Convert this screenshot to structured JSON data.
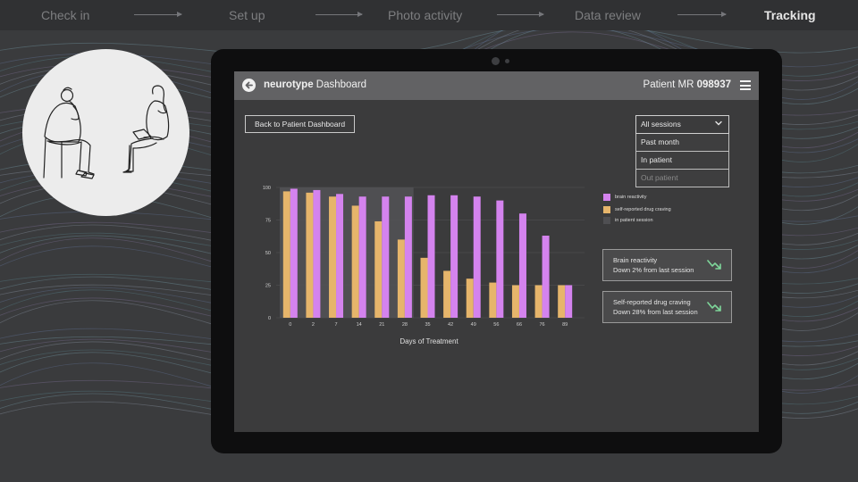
{
  "stepper": {
    "steps": [
      "Check in",
      "Set up",
      "Photo activity",
      "Data review",
      "Tracking"
    ],
    "active_index": 4
  },
  "tablet": {
    "brand_bold": "neurotype",
    "brand_rest": " Dashboard",
    "patient_prefix": "Patient MR ",
    "patient_id": "098937",
    "back_button_label": "Back to Patient Dashboard",
    "dropdown": {
      "selected": "All sessions",
      "options": [
        "Past month",
        "In patient",
        "Out patient"
      ]
    },
    "legend": {
      "brain": "brain reactivity",
      "craving": "self-reported drug craving",
      "session": "in patient session"
    },
    "cards": [
      {
        "title": "Brain reactivity",
        "subtitle": "Down 2% from last session"
      },
      {
        "title": "Self-reported drug craving",
        "subtitle": "Down 28% from last session"
      }
    ]
  },
  "colors": {
    "brain": "#d483ee",
    "craving": "#e6b56b",
    "session": "#4f4f52",
    "trend": "#7ed69a"
  },
  "icons": [
    "back-arrow-icon",
    "menu-icon",
    "chevron-down-icon",
    "trend-down-icon"
  ],
  "chart_data": {
    "type": "bar",
    "xlabel": "Days of Treatment",
    "ylabel": "",
    "ylim": [
      0,
      100
    ],
    "yticks": [
      0,
      25,
      50,
      75,
      100
    ],
    "categories": [
      "0",
      "2",
      "7",
      "14",
      "21",
      "28",
      "35",
      "42",
      "49",
      "56",
      "66",
      "76",
      "89"
    ],
    "series": [
      {
        "name": "self-reported drug craving",
        "values": [
          97,
          96,
          93,
          86,
          74,
          60,
          46,
          36,
          30,
          27,
          25,
          25,
          25
        ]
      },
      {
        "name": "brain reactivity",
        "values": [
          99,
          98,
          95,
          93,
          93,
          93,
          94,
          94,
          93,
          90,
          80,
          63,
          25
        ]
      }
    ],
    "in_patient_session_days": [
      "0",
      "2",
      "7",
      "14",
      "21",
      "28"
    ],
    "grid": true,
    "legend_position": "right"
  }
}
